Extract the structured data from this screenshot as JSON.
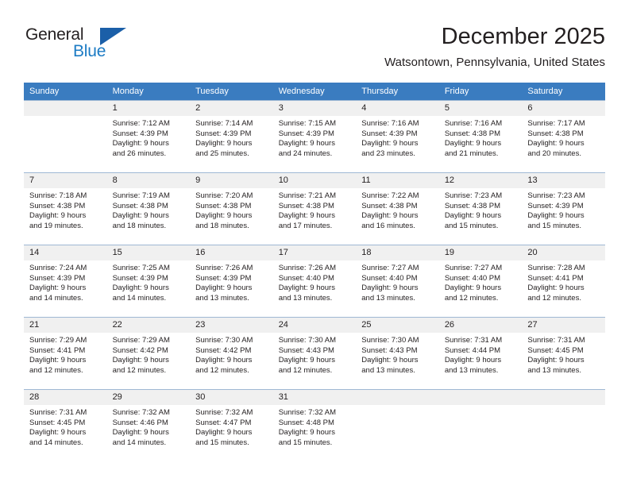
{
  "brand": {
    "name_part1": "General",
    "name_part2": "Blue",
    "logo_icon": "triangle-logo-icon",
    "accent_color": "#1c7bc4",
    "logo_color": "#1b5fa8"
  },
  "header": {
    "title": "December 2025",
    "subtitle": "Watsontown, Pennsylvania, United States"
  },
  "calendar": {
    "header_bg_color": "#3a7cc0",
    "daynum_bg_color": "#f0f0f0",
    "weekday_headers": [
      "Sunday",
      "Monday",
      "Tuesday",
      "Wednesday",
      "Thursday",
      "Friday",
      "Saturday"
    ],
    "weeks": [
      [
        {
          "day": "",
          "sunrise": "",
          "sunset": "",
          "daylight_line1": "",
          "daylight_line2": "",
          "empty": true
        },
        {
          "day": "1",
          "sunrise": "Sunrise: 7:12 AM",
          "sunset": "Sunset: 4:39 PM",
          "daylight_line1": "Daylight: 9 hours",
          "daylight_line2": "and 26 minutes.",
          "empty": false
        },
        {
          "day": "2",
          "sunrise": "Sunrise: 7:14 AM",
          "sunset": "Sunset: 4:39 PM",
          "daylight_line1": "Daylight: 9 hours",
          "daylight_line2": "and 25 minutes.",
          "empty": false
        },
        {
          "day": "3",
          "sunrise": "Sunrise: 7:15 AM",
          "sunset": "Sunset: 4:39 PM",
          "daylight_line1": "Daylight: 9 hours",
          "daylight_line2": "and 24 minutes.",
          "empty": false
        },
        {
          "day": "4",
          "sunrise": "Sunrise: 7:16 AM",
          "sunset": "Sunset: 4:39 PM",
          "daylight_line1": "Daylight: 9 hours",
          "daylight_line2": "and 23 minutes.",
          "empty": false
        },
        {
          "day": "5",
          "sunrise": "Sunrise: 7:16 AM",
          "sunset": "Sunset: 4:38 PM",
          "daylight_line1": "Daylight: 9 hours",
          "daylight_line2": "and 21 minutes.",
          "empty": false
        },
        {
          "day": "6",
          "sunrise": "Sunrise: 7:17 AM",
          "sunset": "Sunset: 4:38 PM",
          "daylight_line1": "Daylight: 9 hours",
          "daylight_line2": "and 20 minutes.",
          "empty": false
        }
      ],
      [
        {
          "day": "7",
          "sunrise": "Sunrise: 7:18 AM",
          "sunset": "Sunset: 4:38 PM",
          "daylight_line1": "Daylight: 9 hours",
          "daylight_line2": "and 19 minutes.",
          "empty": false
        },
        {
          "day": "8",
          "sunrise": "Sunrise: 7:19 AM",
          "sunset": "Sunset: 4:38 PM",
          "daylight_line1": "Daylight: 9 hours",
          "daylight_line2": "and 18 minutes.",
          "empty": false
        },
        {
          "day": "9",
          "sunrise": "Sunrise: 7:20 AM",
          "sunset": "Sunset: 4:38 PM",
          "daylight_line1": "Daylight: 9 hours",
          "daylight_line2": "and 18 minutes.",
          "empty": false
        },
        {
          "day": "10",
          "sunrise": "Sunrise: 7:21 AM",
          "sunset": "Sunset: 4:38 PM",
          "daylight_line1": "Daylight: 9 hours",
          "daylight_line2": "and 17 minutes.",
          "empty": false
        },
        {
          "day": "11",
          "sunrise": "Sunrise: 7:22 AM",
          "sunset": "Sunset: 4:38 PM",
          "daylight_line1": "Daylight: 9 hours",
          "daylight_line2": "and 16 minutes.",
          "empty": false
        },
        {
          "day": "12",
          "sunrise": "Sunrise: 7:23 AM",
          "sunset": "Sunset: 4:38 PM",
          "daylight_line1": "Daylight: 9 hours",
          "daylight_line2": "and 15 minutes.",
          "empty": false
        },
        {
          "day": "13",
          "sunrise": "Sunrise: 7:23 AM",
          "sunset": "Sunset: 4:39 PM",
          "daylight_line1": "Daylight: 9 hours",
          "daylight_line2": "and 15 minutes.",
          "empty": false
        }
      ],
      [
        {
          "day": "14",
          "sunrise": "Sunrise: 7:24 AM",
          "sunset": "Sunset: 4:39 PM",
          "daylight_line1": "Daylight: 9 hours",
          "daylight_line2": "and 14 minutes.",
          "empty": false
        },
        {
          "day": "15",
          "sunrise": "Sunrise: 7:25 AM",
          "sunset": "Sunset: 4:39 PM",
          "daylight_line1": "Daylight: 9 hours",
          "daylight_line2": "and 14 minutes.",
          "empty": false
        },
        {
          "day": "16",
          "sunrise": "Sunrise: 7:26 AM",
          "sunset": "Sunset: 4:39 PM",
          "daylight_line1": "Daylight: 9 hours",
          "daylight_line2": "and 13 minutes.",
          "empty": false
        },
        {
          "day": "17",
          "sunrise": "Sunrise: 7:26 AM",
          "sunset": "Sunset: 4:40 PM",
          "daylight_line1": "Daylight: 9 hours",
          "daylight_line2": "and 13 minutes.",
          "empty": false
        },
        {
          "day": "18",
          "sunrise": "Sunrise: 7:27 AM",
          "sunset": "Sunset: 4:40 PM",
          "daylight_line1": "Daylight: 9 hours",
          "daylight_line2": "and 13 minutes.",
          "empty": false
        },
        {
          "day": "19",
          "sunrise": "Sunrise: 7:27 AM",
          "sunset": "Sunset: 4:40 PM",
          "daylight_line1": "Daylight: 9 hours",
          "daylight_line2": "and 12 minutes.",
          "empty": false
        },
        {
          "day": "20",
          "sunrise": "Sunrise: 7:28 AM",
          "sunset": "Sunset: 4:41 PM",
          "daylight_line1": "Daylight: 9 hours",
          "daylight_line2": "and 12 minutes.",
          "empty": false
        }
      ],
      [
        {
          "day": "21",
          "sunrise": "Sunrise: 7:29 AM",
          "sunset": "Sunset: 4:41 PM",
          "daylight_line1": "Daylight: 9 hours",
          "daylight_line2": "and 12 minutes.",
          "empty": false
        },
        {
          "day": "22",
          "sunrise": "Sunrise: 7:29 AM",
          "sunset": "Sunset: 4:42 PM",
          "daylight_line1": "Daylight: 9 hours",
          "daylight_line2": "and 12 minutes.",
          "empty": false
        },
        {
          "day": "23",
          "sunrise": "Sunrise: 7:30 AM",
          "sunset": "Sunset: 4:42 PM",
          "daylight_line1": "Daylight: 9 hours",
          "daylight_line2": "and 12 minutes.",
          "empty": false
        },
        {
          "day": "24",
          "sunrise": "Sunrise: 7:30 AM",
          "sunset": "Sunset: 4:43 PM",
          "daylight_line1": "Daylight: 9 hours",
          "daylight_line2": "and 12 minutes.",
          "empty": false
        },
        {
          "day": "25",
          "sunrise": "Sunrise: 7:30 AM",
          "sunset": "Sunset: 4:43 PM",
          "daylight_line1": "Daylight: 9 hours",
          "daylight_line2": "and 13 minutes.",
          "empty": false
        },
        {
          "day": "26",
          "sunrise": "Sunrise: 7:31 AM",
          "sunset": "Sunset: 4:44 PM",
          "daylight_line1": "Daylight: 9 hours",
          "daylight_line2": "and 13 minutes.",
          "empty": false
        },
        {
          "day": "27",
          "sunrise": "Sunrise: 7:31 AM",
          "sunset": "Sunset: 4:45 PM",
          "daylight_line1": "Daylight: 9 hours",
          "daylight_line2": "and 13 minutes.",
          "empty": false
        }
      ],
      [
        {
          "day": "28",
          "sunrise": "Sunrise: 7:31 AM",
          "sunset": "Sunset: 4:45 PM",
          "daylight_line1": "Daylight: 9 hours",
          "daylight_line2": "and 14 minutes.",
          "empty": false
        },
        {
          "day": "29",
          "sunrise": "Sunrise: 7:32 AM",
          "sunset": "Sunset: 4:46 PM",
          "daylight_line1": "Daylight: 9 hours",
          "daylight_line2": "and 14 minutes.",
          "empty": false
        },
        {
          "day": "30",
          "sunrise": "Sunrise: 7:32 AM",
          "sunset": "Sunset: 4:47 PM",
          "daylight_line1": "Daylight: 9 hours",
          "daylight_line2": "and 15 minutes.",
          "empty": false
        },
        {
          "day": "31",
          "sunrise": "Sunrise: 7:32 AM",
          "sunset": "Sunset: 4:48 PM",
          "daylight_line1": "Daylight: 9 hours",
          "daylight_line2": "and 15 minutes.",
          "empty": false
        },
        {
          "day": "",
          "sunrise": "",
          "sunset": "",
          "daylight_line1": "",
          "daylight_line2": "",
          "empty": true
        },
        {
          "day": "",
          "sunrise": "",
          "sunset": "",
          "daylight_line1": "",
          "daylight_line2": "",
          "empty": true
        },
        {
          "day": "",
          "sunrise": "",
          "sunset": "",
          "daylight_line1": "",
          "daylight_line2": "",
          "empty": true
        }
      ]
    ]
  }
}
